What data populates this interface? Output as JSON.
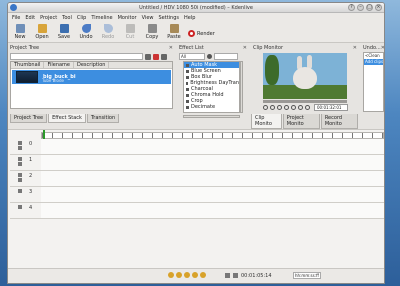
{
  "window": {
    "title": "Untitled / HDV 1080 50i (modified) – Kdenlive",
    "buttons": [
      "?",
      "–",
      "□",
      "×"
    ]
  },
  "menu": [
    "File",
    "Edit",
    "Project",
    "Tool",
    "Clip",
    "Timeline",
    "Monitor",
    "View",
    "Settings",
    "Help"
  ],
  "toolbar": [
    {
      "label": "New",
      "icon": "new-doc-icon",
      "color": "#6f8fb8",
      "enabled": true
    },
    {
      "label": "Open",
      "icon": "folder-open-icon",
      "color": "#d8a43a",
      "enabled": true
    },
    {
      "label": "Save",
      "icon": "save-icon",
      "color": "#3c6fb0",
      "enabled": true
    },
    {
      "label": "Undo",
      "icon": "undo-icon",
      "color": "#4c7cc6",
      "enabled": true
    },
    {
      "label": "Redo",
      "icon": "redo-icon",
      "color": "#4c7cc6",
      "enabled": false
    },
    {
      "label": "Cut",
      "icon": "cut-icon",
      "color": "#777",
      "enabled": false
    },
    {
      "label": "Copy",
      "icon": "copy-icon",
      "color": "#8a8a8a",
      "enabled": true
    },
    {
      "label": "Paste",
      "icon": "paste-icon",
      "color": "#a78a58",
      "enabled": true
    }
  ],
  "render_label": "Render",
  "project_tree": {
    "title": "Project Tree",
    "columns": [
      "Thumbnail",
      "Filename",
      "Description"
    ],
    "clips": [
      {
        "name": "big_buck_bi",
        "duration": "Tube Blode"
      }
    ],
    "tabs": [
      "Project Tree",
      "Effect Stack",
      "Transition"
    ],
    "active_tab": 1
  },
  "effect_list": {
    "title": "Effect List",
    "filter": "All",
    "items": [
      "Auto Mask",
      "Blue Screen",
      "Box Blur",
      "Brightness DayTran",
      "Charcoal",
      "Chroma Hold",
      "Crop",
      "Decimate"
    ],
    "selected": 0
  },
  "clip_monitor": {
    "title": "Clip Monitor",
    "timecode": "00:01:32:01",
    "tabs": [
      "Clip Monito",
      "Project Monito",
      "Record Monito"
    ]
  },
  "undo_history": {
    "title": "Undo...",
    "items": [
      "<Clean",
      "Add clips"
    ],
    "selected": 1
  },
  "timeline": {
    "tracks": [
      "0",
      "1",
      "2",
      "3",
      "4"
    ]
  },
  "status": {
    "timecode": "00:01:05:14",
    "zoom": "hh:mm:ss:ff"
  }
}
